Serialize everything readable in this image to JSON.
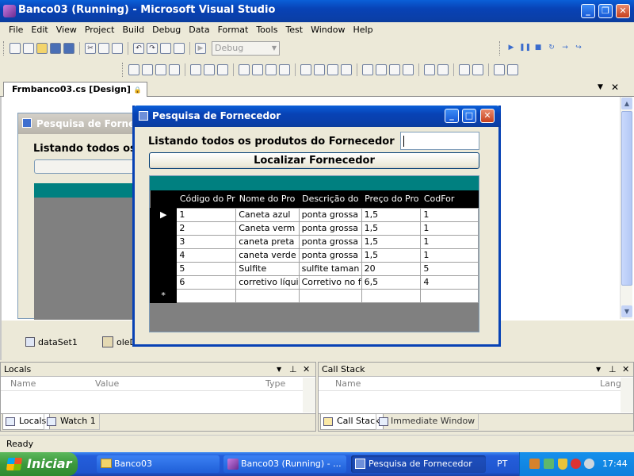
{
  "window": {
    "title": "Banco03 (Running) - Microsoft Visual Studio"
  },
  "menu": [
    "File",
    "Edit",
    "View",
    "Project",
    "Build",
    "Debug",
    "Data",
    "Format",
    "Tools",
    "Test",
    "Window",
    "Help"
  ],
  "toolbar": {
    "config_value": "Debug"
  },
  "doc_tab": {
    "label": "Frmbanco03.cs [Design]"
  },
  "designer": {
    "form_title": "Pesquisa de Fornece",
    "label": "Listando todos os",
    "components": [
      "dataSet1",
      "oleD"
    ]
  },
  "dialog": {
    "title": "Pesquisa de Fornecedor",
    "label": "Listando todos os produtos do Fornecedor",
    "input_value": "",
    "button": "Localizar Fornecedor",
    "grid": {
      "columns": [
        "Código do Pr",
        "Nome do Pro",
        "Descrição do",
        "Preço do Pro",
        "CodFor"
      ],
      "rows": [
        [
          "1",
          "Caneta azul",
          "ponta grossa",
          "1,5",
          "1"
        ],
        [
          "2",
          "Caneta verm",
          "ponta grossa",
          "1,5",
          "1"
        ],
        [
          "3",
          "caneta preta",
          "ponta grossa",
          "1,5",
          "1"
        ],
        [
          "4",
          "caneta verde",
          "ponta grossa",
          "1,5",
          "1"
        ],
        [
          "5",
          "Sulfite",
          "sulfite taman",
          "20",
          "5"
        ],
        [
          "6",
          "corretivo líqui",
          "Corretivo no f",
          "6,5",
          "4"
        ]
      ],
      "new_row_marker": "*"
    }
  },
  "locals": {
    "title": "Locals",
    "columns": [
      "Name",
      "Value",
      "Type"
    ],
    "tabs": [
      "Locals",
      "Watch 1"
    ]
  },
  "callstack": {
    "title": "Call Stack",
    "columns": [
      "Name",
      "Langu"
    ],
    "tabs": [
      "Call Stack",
      "Immediate Window"
    ]
  },
  "status": {
    "text": "Ready"
  },
  "taskbar": {
    "start": "Iniciar",
    "items": [
      "Banco03",
      "Banco03 (Running) - ...",
      "Pesquisa de Fornecedor"
    ],
    "lang": "PT",
    "clock": "17:44"
  }
}
